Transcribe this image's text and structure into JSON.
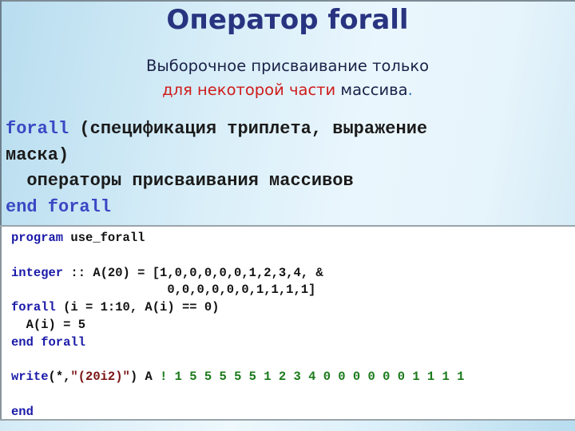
{
  "title": "Оператор forall",
  "subtitle": {
    "line1": "Выборочное присваивание только",
    "line2_highlight": "для некоторой части",
    "line2_rest": " массива",
    "line2_end": "."
  },
  "syntax": {
    "line1_kw": "forall",
    "line1_rest": " (спецификация триплета, выражение",
    "line2": "маска)",
    "line3": "  операторы присваивания массивов",
    "line4_kw": "end forall"
  },
  "code": {
    "l1_kw": "program",
    "l1_rest": " use_forall",
    "l3_kw": "integer",
    "l3_rest": " :: A(20) = [1,0,0,0,0,0,1,2,3,4, &",
    "l4": "                     0,0,0,0,0,0,1,1,1,1]",
    "l5_kw": "forall",
    "l5_rest": " (i = 1:10, A(i) == 0)",
    "l6": "  A(i) = 5",
    "l7_kw": "end forall",
    "l9_kw": "write",
    "l9_a": "(*,",
    "l9_str": "\"(20i2)\"",
    "l9_b": ") A ",
    "l9_cmt": "! 1 5 5 5 5 5 1 2 3 4 0 0 0 0 0 0 1 1 1 1",
    "l11_kw": "end"
  },
  "colors": {
    "title": "#283480",
    "highlight_red": "#d01c1c",
    "keyword_blue": "#1a1aa8",
    "string_red": "#7a1414",
    "comment_green": "#1a7a1a"
  }
}
